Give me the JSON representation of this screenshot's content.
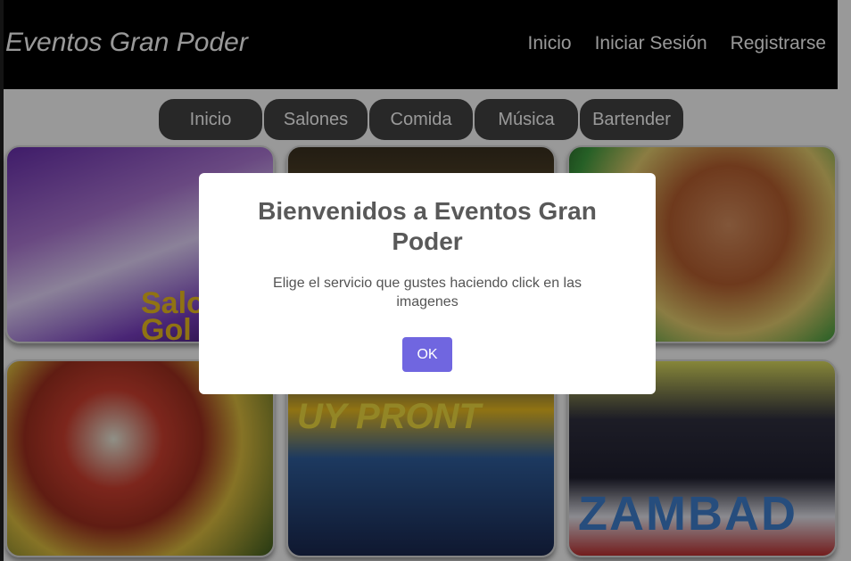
{
  "header": {
    "brand": "Eventos Gran Poder",
    "nav": [
      "Inicio",
      "Iniciar Sesión",
      "Registrarse"
    ]
  },
  "categories": [
    "Inicio",
    "Salones",
    "Comida",
    "Música",
    "Bartender"
  ],
  "cards": {
    "salon_text": "Salo\nGol",
    "music1_text": "UY PRONT",
    "music2_text": "ZAMBAD"
  },
  "modal": {
    "title": "Bienvenidos a Eventos Gran Poder",
    "text": "Elige el servicio que gustes haciendo click en las imagenes",
    "ok_label": "OK"
  },
  "colors": {
    "header_bg": "#000000",
    "pill_bg": "#444444",
    "ok_button": "#7066e0",
    "overlay": "rgba(0,0,0,0.4)"
  }
}
